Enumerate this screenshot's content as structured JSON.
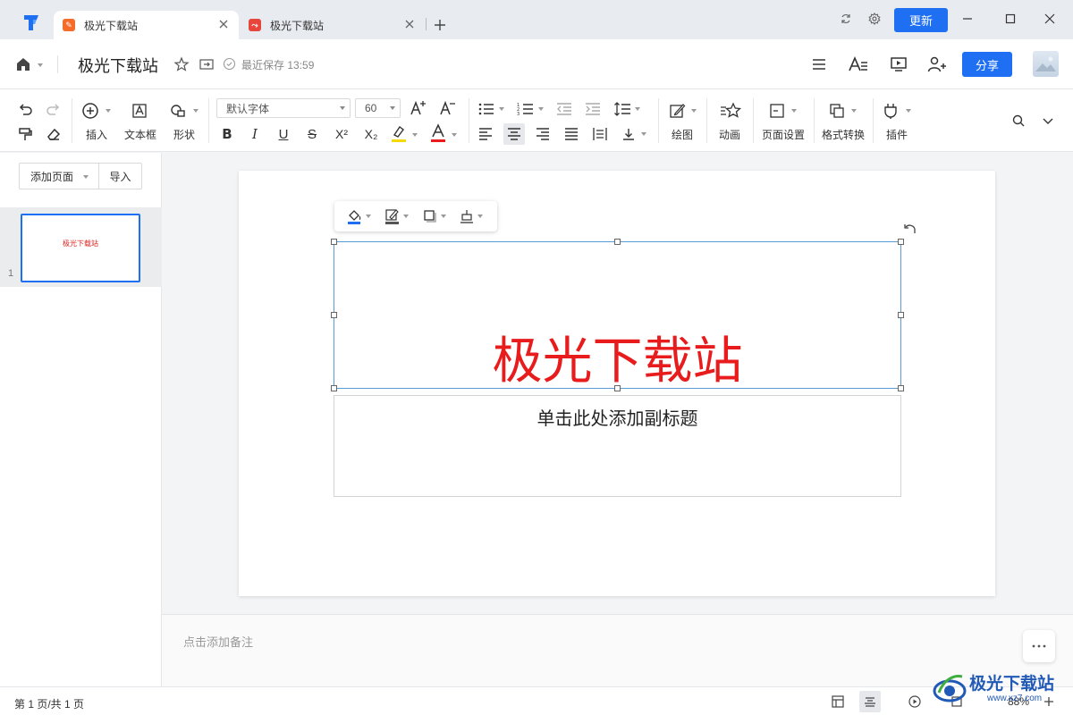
{
  "tabs": [
    {
      "label": "极光下载站",
      "icon": "office-icon",
      "color": "#f56b2a",
      "active": true
    },
    {
      "label": "极光下载站",
      "icon": "pdf-icon",
      "color": "#e8453c",
      "active": false
    }
  ],
  "window": {
    "update_label": "更新"
  },
  "header": {
    "doc_title": "极光下载站",
    "save_status": "最近保存 13:59",
    "share_label": "分享"
  },
  "toolbar": {
    "insert_label": "插入",
    "textbox_label": "文本框",
    "shape_label": "形状",
    "font_name": "默认字体",
    "font_size": "60",
    "draw_label": "绘图",
    "animation_label": "动画",
    "page_setup_label": "页面设置",
    "format_convert_label": "格式转换",
    "plugin_label": "插件",
    "highlight_color": "#f5d90a",
    "font_color": "#e81c1c"
  },
  "sidebar": {
    "add_page_label": "添加页面",
    "import_label": "导入",
    "slides": [
      {
        "number": "1",
        "title": "极光下载站"
      }
    ]
  },
  "slide": {
    "title": "极光下载站",
    "subtitle_placeholder": "单击此处添加副标题",
    "title_color": "#e81c1c"
  },
  "notes": {
    "placeholder": "点击添加备注"
  },
  "status": {
    "page_indicator": "第 1 页/共 1 页",
    "zoom": "88%"
  },
  "watermark": {
    "text": "极光下载站",
    "url": "www.xz7.com"
  }
}
